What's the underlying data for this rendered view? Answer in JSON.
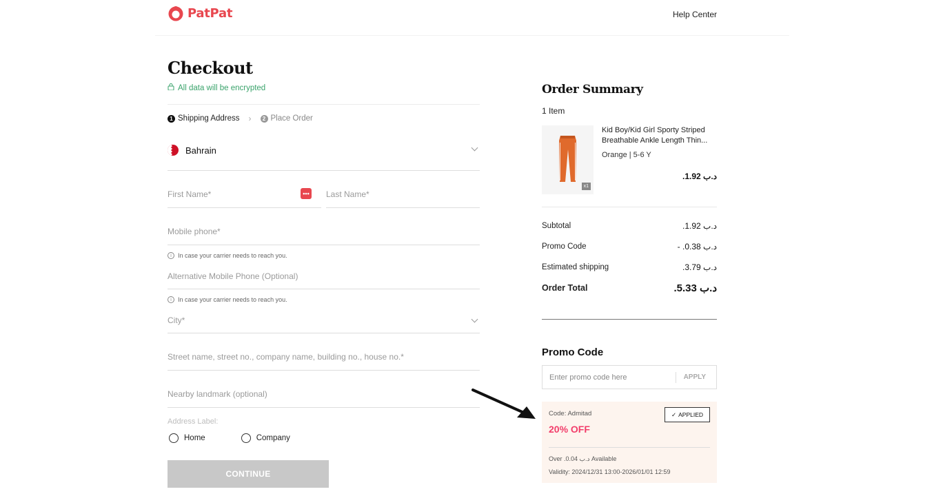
{
  "header": {
    "brand": "PatPat",
    "help_center": "Help Center"
  },
  "checkout": {
    "title": "Checkout",
    "encrypt_note": "All data will be encrypted",
    "steps": [
      {
        "num": "1",
        "label": "Shipping Address"
      },
      {
        "num": "2",
        "label": "Place Order"
      }
    ],
    "country": "Bahrain",
    "fields": {
      "first_name": "First Name*",
      "last_name": "Last Name*",
      "mobile": "Mobile phone*",
      "mobile_hint": "In case your carrier needs to reach you.",
      "alt_mobile": "Alternative Mobile Phone (Optional)",
      "alt_mobile_hint": "In case your carrier needs to reach you.",
      "city": "City*",
      "street": "Street name, street no., company name, building no., house no.*",
      "landmark": "Nearby landmark (optional)",
      "address_label": "Address Label:",
      "label_home": "Home",
      "label_company": "Company"
    },
    "continue_label": "CONTINUE"
  },
  "summary": {
    "title": "Order Summary",
    "items_count": "1 Item",
    "product": {
      "name": "Kid Boy/Kid Girl Sporty Striped Breathable Ankle Length Thin...",
      "variant": "Orange | 5-6 Y",
      "price": ".د.ب 1.92",
      "qty": "x1"
    },
    "rows": [
      {
        "label": "Subtotal",
        "value": ".د.ب 1.92"
      },
      {
        "label": "Promo Code",
        "value": "- .د.ب 0.38"
      },
      {
        "label": "Estimated shipping",
        "value": ".د.ب 3.79"
      }
    ],
    "total_label": "Order Total",
    "total_value": ".د.ب 5.33"
  },
  "promo": {
    "title": "Promo Code",
    "placeholder": "Enter promo code here",
    "apply": "APPLY",
    "coupon": {
      "code": "Code: Admitad",
      "off": "20% OFF",
      "applied": "APPLIED",
      "available": "Over .د.ب 0.04 Available",
      "validity": "Validity: 2024/12/31 13:00-2026/01/01 12:59"
    }
  },
  "colors": {
    "brand": "#e8474f",
    "encrypt_green": "#3aa36b",
    "coupon_pink": "#f23d6a",
    "coupon_bg": "#fdf4ee"
  }
}
